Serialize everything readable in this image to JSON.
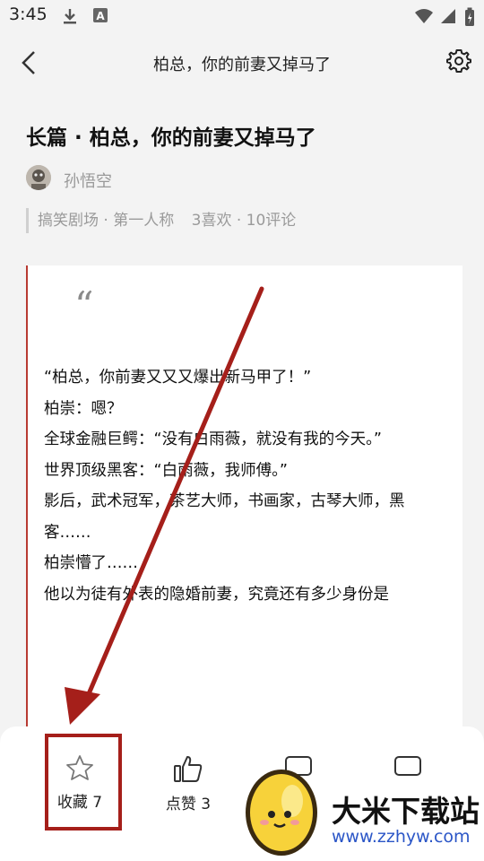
{
  "status_bar": {
    "time": "3:45"
  },
  "nav": {
    "title": "柏总，你的前妻又掉马了"
  },
  "article": {
    "headline": "长篇 · 柏总，你的前妻又掉马了",
    "author": "孙悟空",
    "tags": "搞笑剧场 · 第一人称",
    "stats": "3喜欢 · 10评论"
  },
  "excerpt": {
    "quote_mark": "“",
    "lines": [
      "“柏总，你前妻又又又爆出新马甲了！”",
      "柏崇：嗯？",
      "全球金融巨鳄：“没有白雨薇，就没有我的今天。”",
      "世界顶级黑客：“白雨薇，我师傅。”",
      "影后，武术冠军，茶艺大师，书画家，古琴大师，黑客……",
      "柏崇懵了……",
      "他以为徒有外表的隐婚前妻，究竟还有多少身份是"
    ]
  },
  "bottom_bar": {
    "collect_label": "收藏 7",
    "like_label": "点赞 3"
  },
  "watermark": {
    "text": "大米下载站",
    "url": "www.zzhyw.com"
  },
  "colors": {
    "accent_red": "#a51f1a",
    "card_border": "#b83a32",
    "link_blue": "#2b56c7"
  }
}
